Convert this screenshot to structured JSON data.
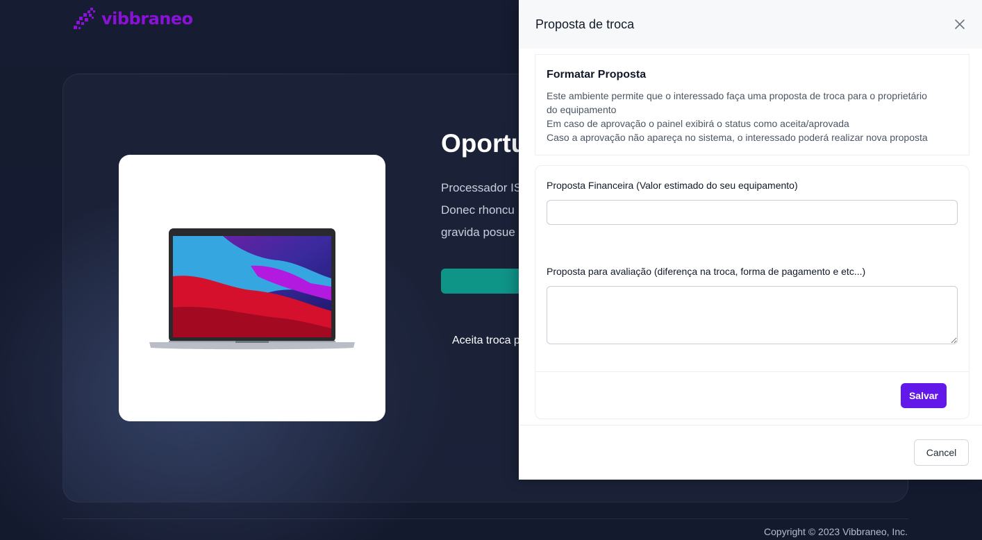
{
  "brand": {
    "name": "vibbraneo",
    "logo_icon": "pixel-arrow-logo-icon",
    "color": "#8a12d8"
  },
  "hero": {
    "title": "Oportu",
    "description_lines": [
      "Processador IS",
      "Donec rhoncu",
      "gravida posue"
    ],
    "note": "Aceita troca p",
    "button_color": "#0f9488"
  },
  "footer": {
    "copyright": "Copyright © 2023 Vibbraneo, Inc."
  },
  "drawer": {
    "title": "Proposta de troca",
    "close_icon": "close-icon",
    "info": {
      "title": "Formatar Proposta",
      "lines": [
        "Este ambiente permite que o interessado faça uma proposta de troca para o proprietário",
        "do equipamento",
        "Em caso de aprovação o painel exibirá o status como aceita/aprovada",
        "Caso a aprovação não apareça no sistema, o interessado poderá realizar nova proposta"
      ]
    },
    "form": {
      "financial_label": "Proposta Financeira (Valor estimado do seu equipamento)",
      "financial_value": "",
      "evaluation_label": "Proposta para avaliação (diferença na troca, forma de pagamento e etc...)",
      "evaluation_value": "",
      "save_label": "Salvar",
      "save_color": "#6218e8"
    },
    "cancel_label": "Cancel"
  }
}
